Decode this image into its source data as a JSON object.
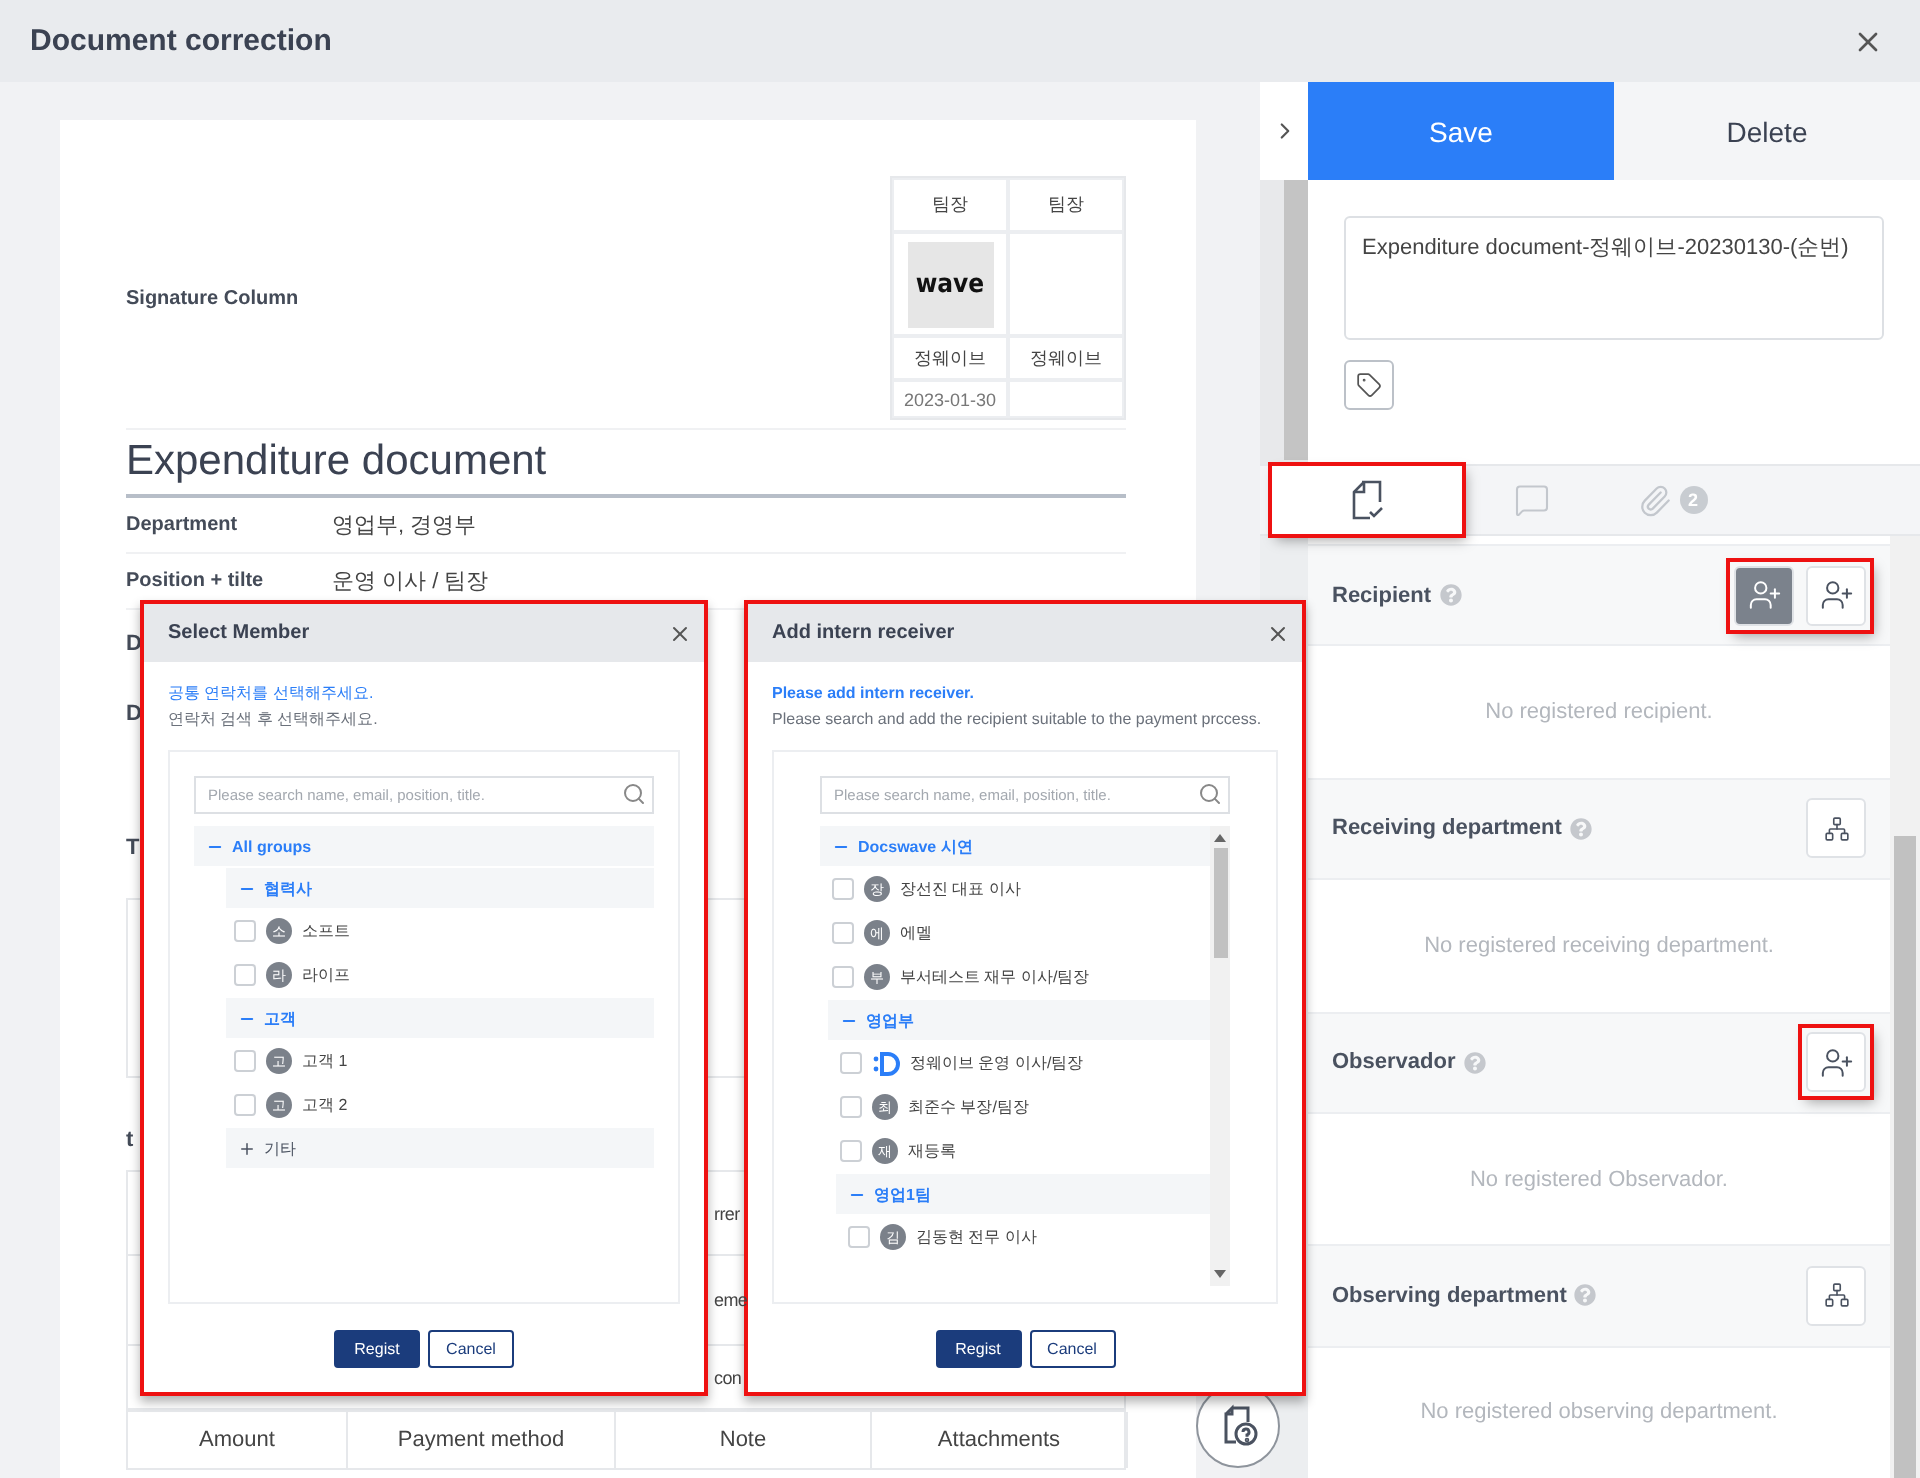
{
  "window": {
    "title": "Document correction"
  },
  "document": {
    "signature": {
      "label": "Signature Column",
      "columns": [
        {
          "role": "팀장",
          "stamp": "wave",
          "name": "정웨이브",
          "date": "2023-01-30"
        },
        {
          "role": "팀장",
          "name": "정웨이브"
        }
      ]
    },
    "title": "Expenditure document",
    "fields": [
      {
        "label": "Department",
        "value": "영업부, 경영부"
      },
      {
        "label": "Position + tilte",
        "value": "운영 이사 / 팀장"
      }
    ],
    "partial_labels": [
      "D",
      "D"
    ],
    "section_fragments": [
      "T",
      "t"
    ],
    "table_fragments": [
      "rrer",
      "eme",
      "con"
    ],
    "table_columns": [
      "Amount",
      "Payment method",
      "Note",
      "Attachments"
    ]
  },
  "modals": [
    {
      "kind": "contacts",
      "title": "Select Member",
      "highlighted": true,
      "hint": "공통 연락처를 선택해주세요.",
      "subhint": "연락처 검색 후 선택해주세요.",
      "search": {
        "placeholder": "Please search name, email, position, title."
      },
      "tree": [
        {
          "kind": "group",
          "label": "All groups",
          "expanded": true,
          "children": [
            {
              "kind": "group",
              "label": "협력사",
              "expanded": true,
              "children": [
                {
                  "kind": "member",
                  "avatar": "소",
                  "label": "소프트",
                  "checked": false
                },
                {
                  "kind": "member",
                  "avatar": "라",
                  "label": "라이프",
                  "checked": false
                }
              ]
            },
            {
              "kind": "group",
              "label": "고객",
              "expanded": true,
              "children": [
                {
                  "kind": "member",
                  "avatar": "고",
                  "label": "고객 1",
                  "checked": false
                },
                {
                  "kind": "member",
                  "avatar": "고",
                  "label": "고객 2",
                  "checked": false
                }
              ]
            },
            {
              "kind": "group",
              "label": "기타",
              "expanded": false
            }
          ]
        }
      ],
      "buttons": [
        {
          "label": "Regist",
          "kind": "primary"
        },
        {
          "label": "Cancel",
          "kind": "secondary"
        }
      ]
    },
    {
      "kind": "receivers",
      "title": "Add intern receiver",
      "highlighted": true,
      "hint": "Please add intern receiver.",
      "subhint": "Please search and add the recipient suitable to the payment prccess.",
      "search": {
        "placeholder": "Please search name, email, position, title."
      },
      "tree": [
        {
          "kind": "group",
          "label": "Docswave 시연",
          "expanded": true,
          "children": [
            {
              "kind": "member",
              "avatar": "장",
              "label": "장선진 대표 이사",
              "checked": false
            },
            {
              "kind": "member",
              "avatar": "에",
              "label": "에멜",
              "checked": false
            },
            {
              "kind": "member",
              "avatar": "부",
              "label": "부서테스트 재무 이사/팀장",
              "checked": false
            },
            {
              "kind": "group",
              "label": "영업부",
              "expanded": true,
              "children": [
                {
                  "kind": "member",
                  "logo": true,
                  "label": "정웨이브 운영 이사/팀장",
                  "checked": false
                },
                {
                  "kind": "member",
                  "avatar": "최",
                  "label": "최준수 부장/팀장",
                  "checked": false
                },
                {
                  "kind": "member",
                  "avatar": "재",
                  "label": "재등록",
                  "checked": false
                },
                {
                  "kind": "group",
                  "label": "영업1팀",
                  "expanded": true,
                  "children": [
                    {
                      "kind": "member",
                      "avatar": "김",
                      "label": "김동현 전무 이사",
                      "checked": false
                    }
                  ]
                }
              ]
            }
          ]
        }
      ],
      "buttons": [
        {
          "label": "Regist",
          "kind": "primary"
        },
        {
          "label": "Cancel",
          "kind": "secondary"
        }
      ]
    }
  ],
  "panel": {
    "actions": [
      {
        "label": "Save",
        "kind": "primary"
      },
      {
        "label": "Delete",
        "kind": "secondary"
      }
    ],
    "document_name": {
      "value": "Expenditure document-정웨이브-20230130-(순번)"
    },
    "tabs": [
      {
        "kind": "document-check",
        "selected": true,
        "highlighted": true
      },
      {
        "kind": "comment",
        "selected": false,
        "highlighted": false
      },
      {
        "kind": "attachment",
        "selected": false,
        "highlighted": false,
        "badge": "2"
      }
    ],
    "sections": [
      {
        "title": "Recipient",
        "highlighted": true,
        "buttons": [
          {
            "kind": "person-add",
            "selected": true
          },
          {
            "kind": "person-add",
            "selected": false
          }
        ],
        "empty_text": "No registered recipient."
      },
      {
        "title": "Receiving department",
        "highlighted": false,
        "buttons": [
          {
            "kind": "org-chart",
            "selected": false
          }
        ],
        "empty_text": "No registered receiving department."
      },
      {
        "title": "Observador",
        "highlighted": true,
        "buttons": [
          {
            "kind": "person-add",
            "selected": false
          }
        ],
        "empty_text": "No registered Observador."
      },
      {
        "title": "Observing department",
        "highlighted": false,
        "buttons": [
          {
            "kind": "org-chart",
            "selected": false
          }
        ],
        "empty_text": "No registered observing department."
      }
    ]
  }
}
